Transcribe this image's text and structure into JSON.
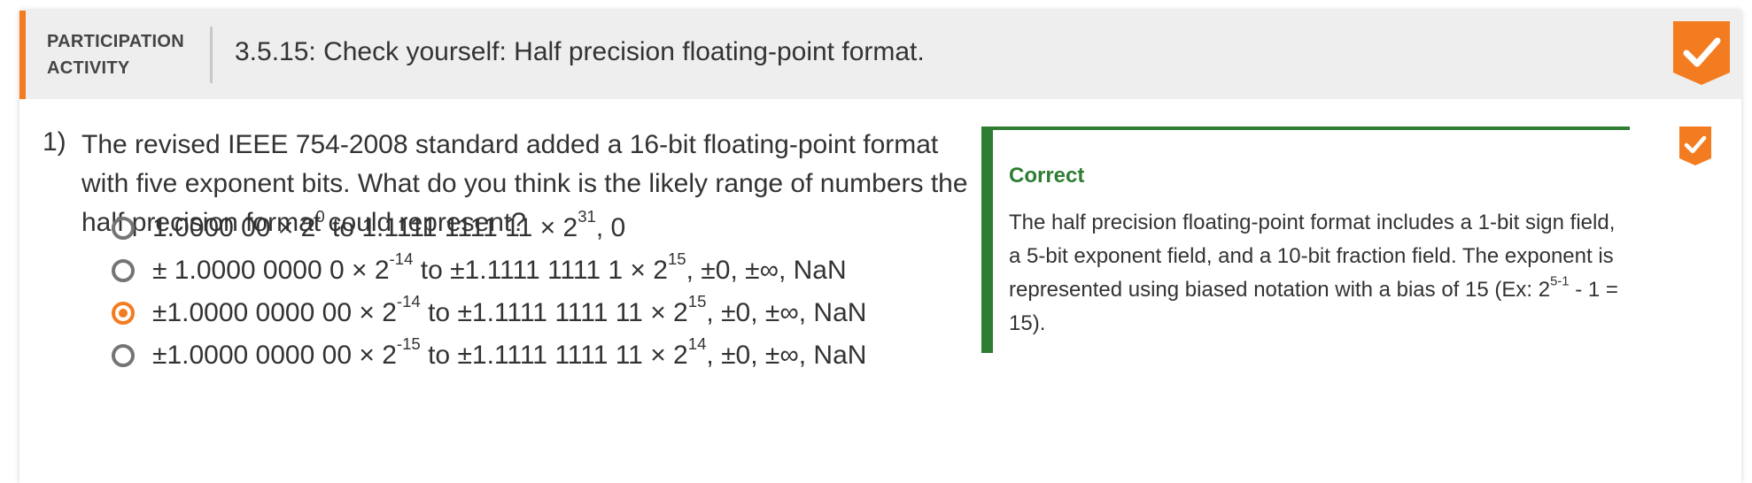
{
  "header": {
    "activity_label_line1": "PARTICIPATION",
    "activity_label_line2": "ACTIVITY",
    "title": "3.5.15: Check yourself: Half precision floating-point format.",
    "completion_icon": "check-icon",
    "accent_color": "#f47c20"
  },
  "question": {
    "number": "1)",
    "text": "The revised IEEE 754-2008 standard added a 16-bit floating-point format with five exponent bits. What do you think is the likely range of numbers the half precision format could represent?",
    "choices": [
      {
        "selected": false,
        "p1": "1.0000 00 × 2",
        "s1": "0",
        "p2": " to 1.1111 1111 11 × 2",
        "s2": "31",
        "p3": ", 0"
      },
      {
        "selected": false,
        "p1": "± 1.0000 0000 0 × 2",
        "s1": "-14",
        "p2": " to ±1.1111 1111 1 × 2",
        "s2": "15",
        "p3": ", ±0, ±∞, NaN"
      },
      {
        "selected": true,
        "p1": "±1.0000 0000 00 × 2",
        "s1": "-14",
        "p2": " to ±1.1111 1111 11 × 2",
        "s2": "15",
        "p3": ", ±0, ±∞, NaN"
      },
      {
        "selected": false,
        "p1": "±1.0000 0000 00 × 2",
        "s1": "-15",
        "p2": " to ±1.1111 1111 11 × 2",
        "s2": "14",
        "p3": ", ±0, ±∞, NaN"
      }
    ],
    "selected_color": "#f47c20",
    "completed_icon": "check-icon"
  },
  "feedback": {
    "title": "Correct",
    "text_before_sup": "The half precision floating-point format includes a 1-bit sign field, a 5-bit exponent field, and a 10-bit fraction field. The exponent is represented using biased notation with a bias of 15 (Ex: 2",
    "sup": "5-1",
    "text_after_sup": " - 1 = 15).",
    "color": "#2e7d32"
  }
}
